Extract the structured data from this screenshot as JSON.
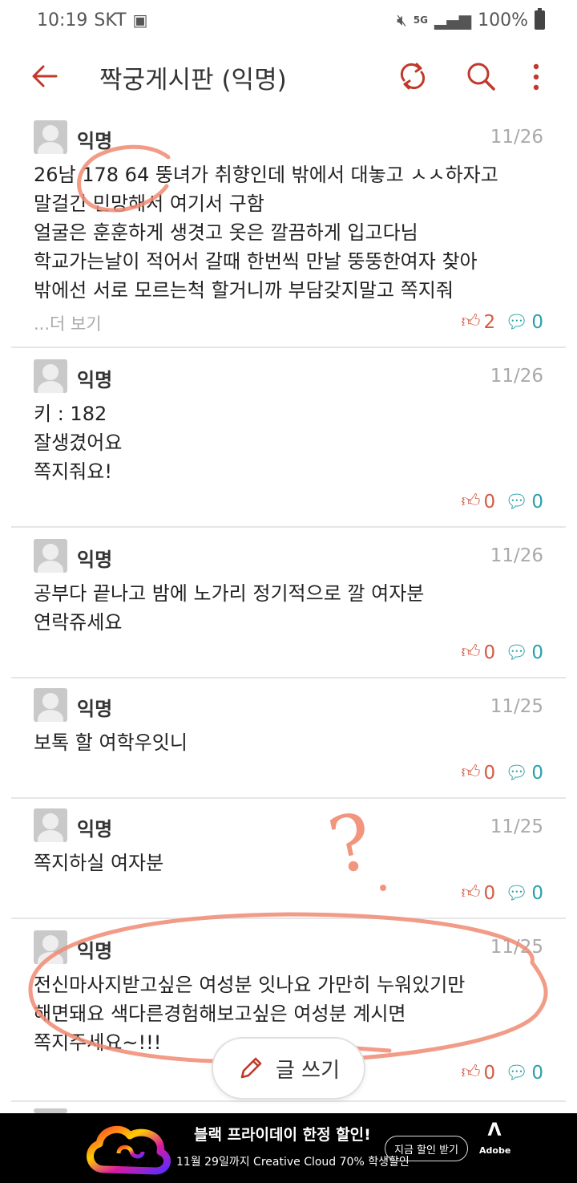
{
  "status_bar": {
    "time": "10:19",
    "carrier": "SKT",
    "network": "5G",
    "battery": "100%"
  },
  "app_bar": {
    "title": "짝궁게시판 (익명)",
    "icons": [
      "back-arrow-icon",
      "refresh-icon",
      "search-icon",
      "more-vert-icon"
    ],
    "accent_color": "#c0392b"
  },
  "posts": [
    {
      "author": "익명",
      "date": "11/26",
      "lines": [
        "26남 178 64 뚱녀가 취향인데 밖에서 대놓고 ㅅㅅ하자고",
        "말걸긴 민망해서 여기서 구함",
        "얼굴은 훈훈하게 생겻고 옷은 깔끔하게 입고다님",
        "학교가는날이 적어서 갈때 한번씩 만날 뚱뚱한여자 찾아",
        "밖에선 서로 모르는척 할거니까 부담갖지말고 쪽지줘"
      ],
      "more": "...더 보기",
      "likes": "2",
      "comments": "0"
    },
    {
      "author": "익명",
      "date": "11/26",
      "lines": [
        "키 : 182",
        "잘생겼어요",
        "쪽지줘요!"
      ],
      "likes": "0",
      "comments": "0"
    },
    {
      "author": "익명",
      "date": "11/26",
      "lines": [
        "공부다 끝나고 밤에 노가리 정기적으로 깔 여자분",
        "연락쥬세요"
      ],
      "likes": "0",
      "comments": "0"
    },
    {
      "author": "익명",
      "date": "11/25",
      "lines": [
        "보톡 할 여학우잇니"
      ],
      "likes": "0",
      "comments": "0"
    },
    {
      "author": "익명",
      "date": "11/25",
      "lines": [
        "쪽지하실 여자분"
      ],
      "likes": "0",
      "comments": "0"
    },
    {
      "author": "익명",
      "date": "11/25",
      "lines": [
        "전신마사지받고싶은 여성분 잇나요 가만히 누워있기만",
        "해면돼요 색다른경험해보고싶은 여성분 계시면",
        "쪽지주세요~!!!"
      ],
      "likes": "0",
      "comments": "0"
    }
  ],
  "write_button": {
    "label": "글 쓰기"
  },
  "ad": {
    "headline": "블랙 프라이데이 한정 할인!",
    "subtext": "11월 29일까지 Creative Cloud 70% 학생할인",
    "cta": "지금 할인 받기",
    "brand": "Adobe"
  },
  "annotation": {
    "mark": "?",
    "color": "#f08a72"
  }
}
